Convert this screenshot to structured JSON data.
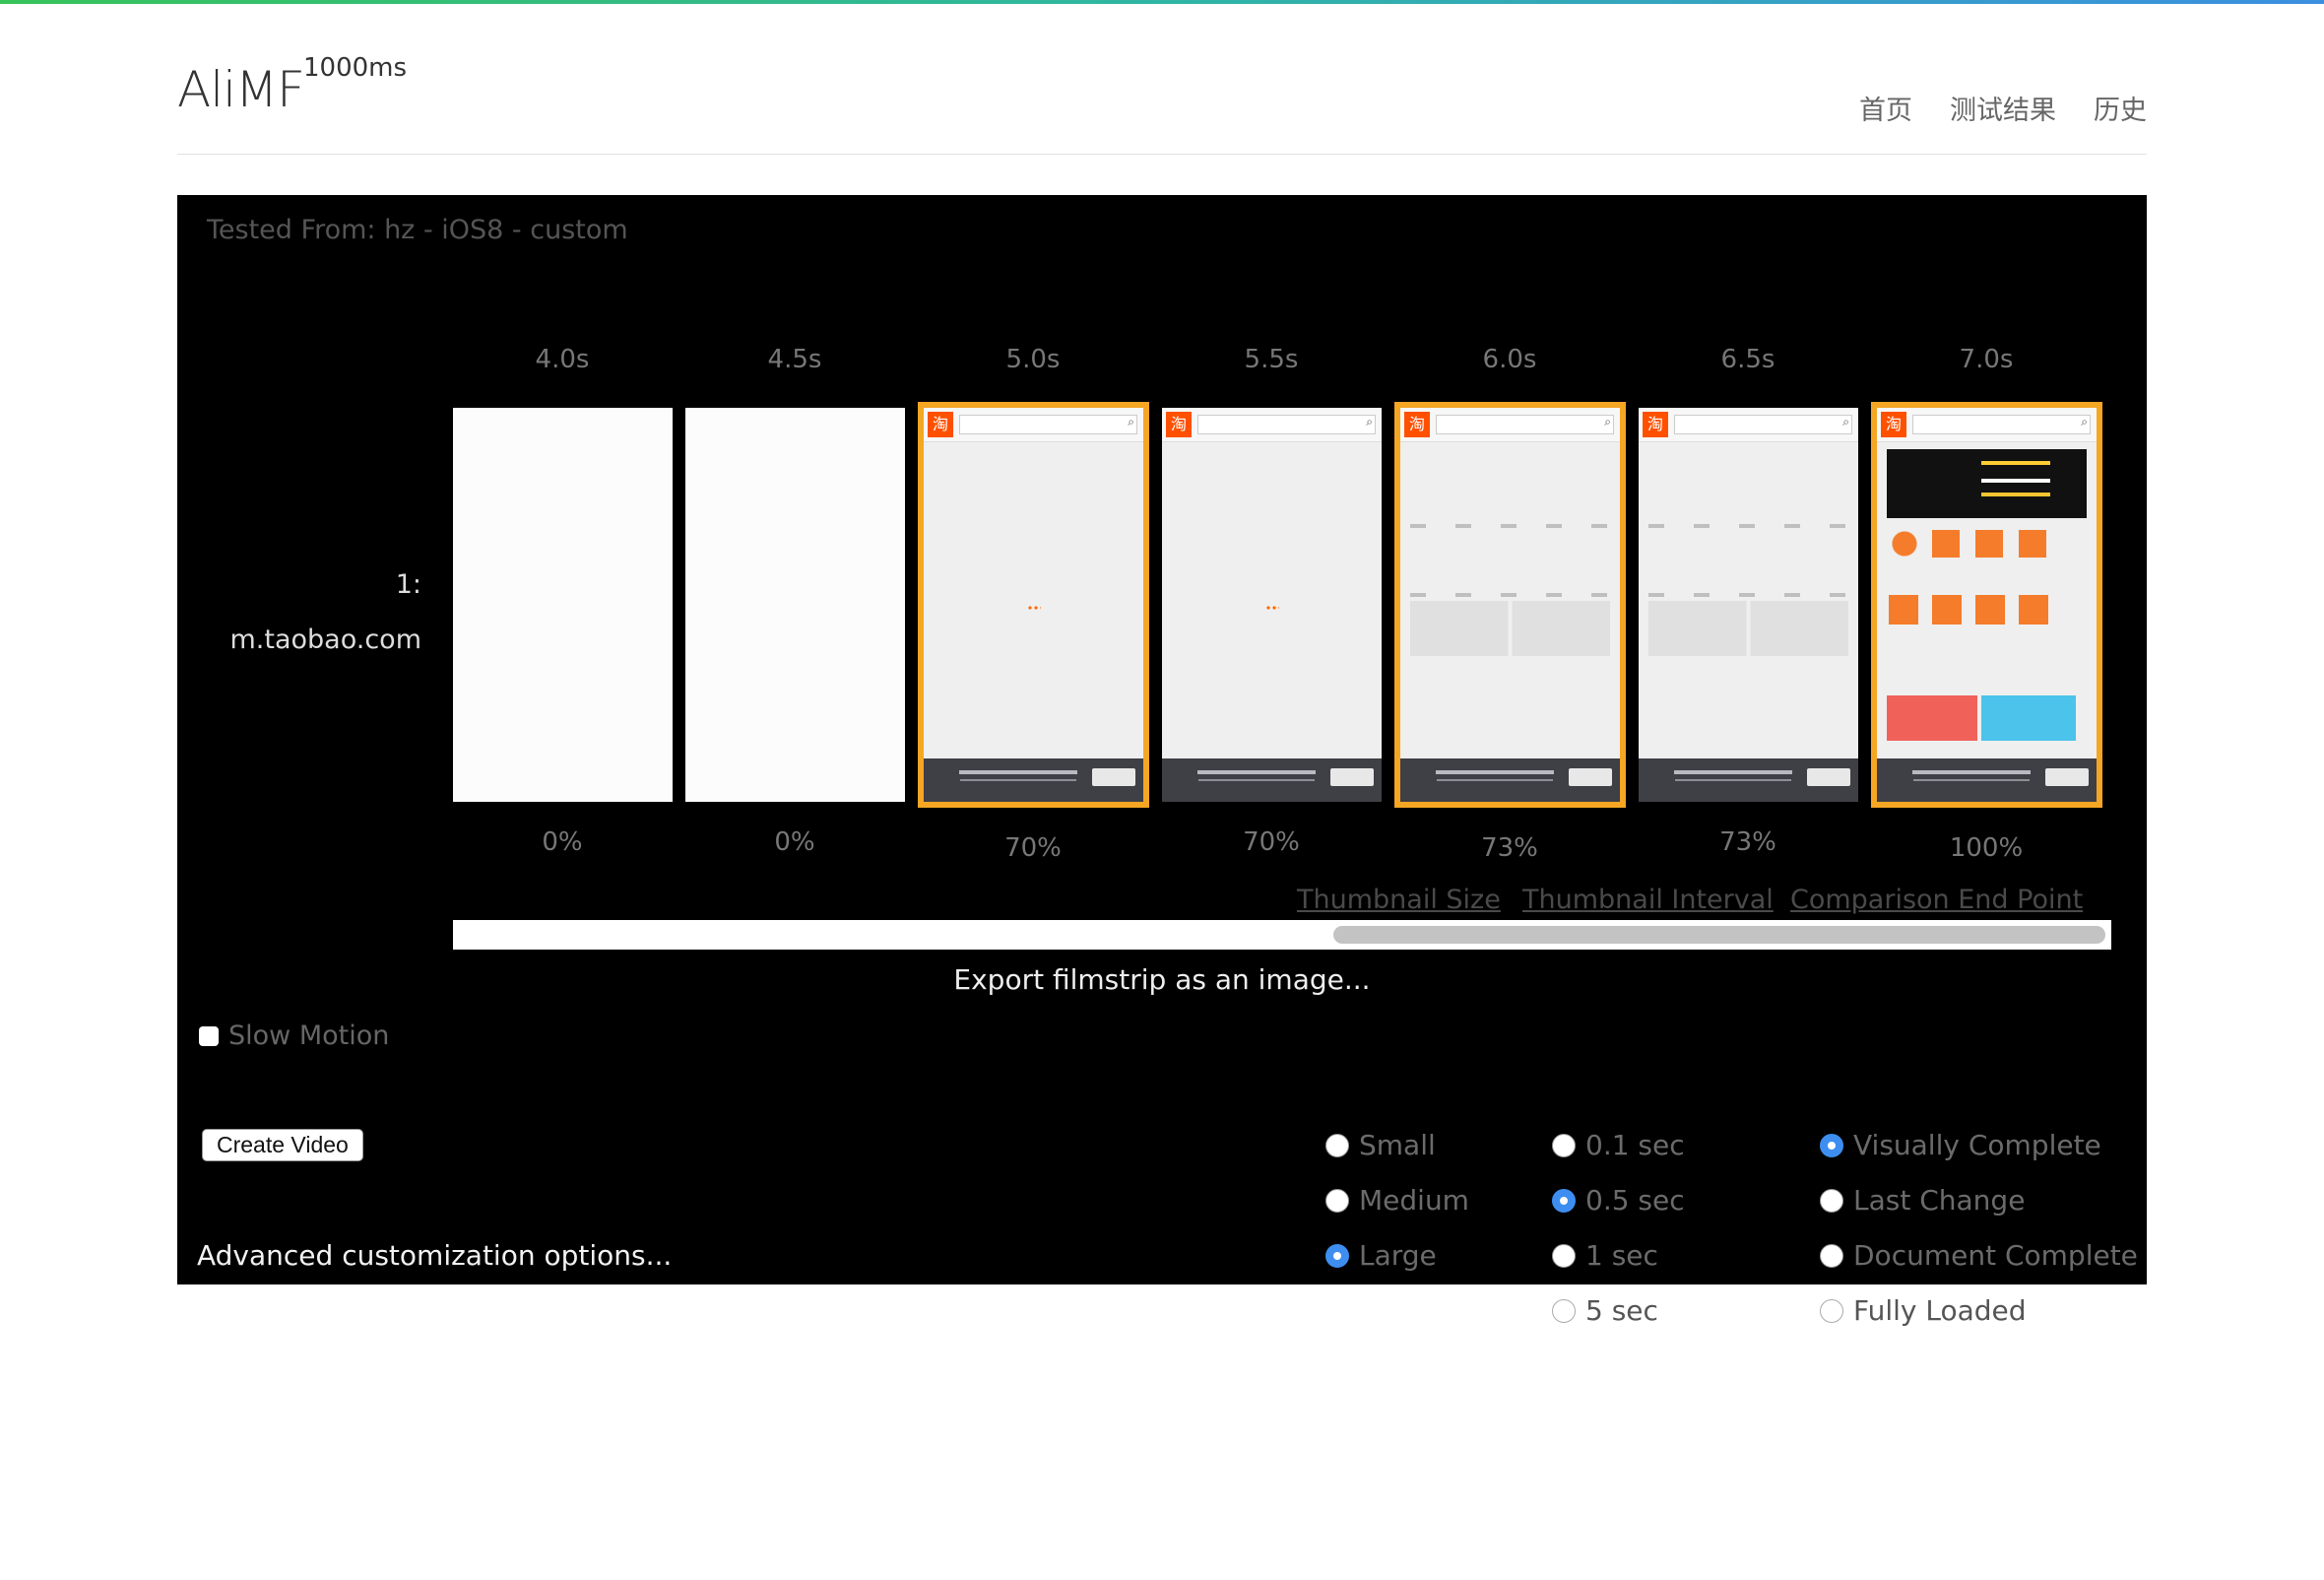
{
  "header": {
    "brand": "AliMF",
    "brand_sup": "1000ms",
    "nav": [
      "首页",
      "测试结果",
      "历史"
    ]
  },
  "panel": {
    "tested_from": "Tested From: hz - iOS8 - custom",
    "row_index": "1:",
    "row_url": "m.taobao.com",
    "frames": [
      {
        "time": "4.0s",
        "percent": "0%",
        "state": "blank",
        "highlight": false
      },
      {
        "time": "4.5s",
        "percent": "0%",
        "state": "blank",
        "highlight": false
      },
      {
        "time": "5.0s",
        "percent": "70%",
        "state": "loading",
        "highlight": true
      },
      {
        "time": "5.5s",
        "percent": "70%",
        "state": "loading",
        "highlight": false
      },
      {
        "time": "6.0s",
        "percent": "73%",
        "state": "partial",
        "highlight": true
      },
      {
        "time": "6.5s",
        "percent": "73%",
        "state": "partial",
        "highlight": false
      },
      {
        "time": "7.0s",
        "percent": "100%",
        "state": "complete",
        "highlight": true
      }
    ],
    "export_label": "Export filmstrip as an image...",
    "slow_motion_label": "Slow Motion",
    "create_video_label": "Create Video",
    "advanced_label": "Advanced customization options..."
  },
  "options": {
    "thumbnail_size": {
      "heading": "Thumbnail Size",
      "items": [
        {
          "label": "Small",
          "selected": false
        },
        {
          "label": "Medium",
          "selected": false
        },
        {
          "label": "Large",
          "selected": true
        }
      ]
    },
    "thumbnail_interval": {
      "heading": "Thumbnail Interval",
      "items": [
        {
          "label": "0.1 sec",
          "selected": false
        },
        {
          "label": "0.5 sec",
          "selected": true
        },
        {
          "label": "1 sec",
          "selected": false
        },
        {
          "label": "5 sec",
          "selected": false
        }
      ]
    },
    "comparison_end_point": {
      "heading": "Comparison End Point",
      "items": [
        {
          "label": "Visually Complete",
          "selected": true
        },
        {
          "label": "Last Change",
          "selected": false
        },
        {
          "label": "Document Complete",
          "selected": false
        },
        {
          "label": "Fully Loaded",
          "selected": false
        }
      ]
    }
  },
  "colors": {
    "highlight_border": "#f5a623",
    "radio_selected": "#3d8ef0",
    "panel_bg": "#000000"
  }
}
